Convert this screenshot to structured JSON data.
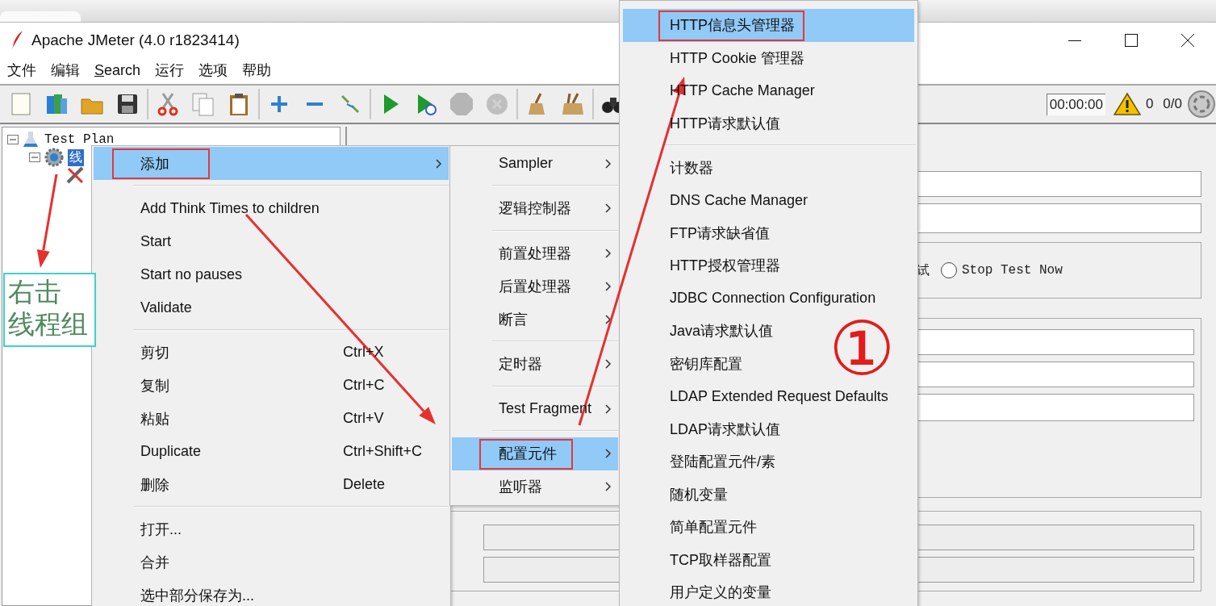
{
  "window": {
    "title": "Apache JMeter (4.0 r1823414)"
  },
  "menu_bar": [
    {
      "label": "文件",
      "underline_first": false
    },
    {
      "label": "编辑",
      "underline_first": false
    },
    {
      "label": "Search",
      "underline_first": true
    },
    {
      "label": "运行",
      "underline_first": false
    },
    {
      "label": "选项",
      "underline_first": false
    },
    {
      "label": "帮助",
      "underline_first": false
    }
  ],
  "toolbar": {
    "buttons": [
      {
        "kind": "new",
        "disabled": false
      },
      {
        "kind": "templates",
        "disabled": false
      },
      {
        "kind": "open",
        "disabled": false
      },
      {
        "kind": "save",
        "disabled": false
      },
      {
        "kind": "separator"
      },
      {
        "kind": "cut",
        "disabled": false
      },
      {
        "kind": "copy",
        "disabled": false
      },
      {
        "kind": "paste",
        "disabled": false
      },
      {
        "kind": "separator"
      },
      {
        "kind": "expand",
        "disabled": false
      },
      {
        "kind": "collapse",
        "disabled": false
      },
      {
        "kind": "toggle",
        "disabled": false
      },
      {
        "kind": "separator"
      },
      {
        "kind": "start",
        "disabled": false
      },
      {
        "kind": "start-no-pause",
        "disabled": false
      },
      {
        "kind": "stop",
        "disabled": true
      },
      {
        "kind": "shutdown",
        "disabled": true
      },
      {
        "kind": "separator"
      },
      {
        "kind": "clear",
        "disabled": false
      },
      {
        "kind": "clear-all",
        "disabled": false
      },
      {
        "kind": "separator"
      },
      {
        "kind": "search",
        "disabled": false
      }
    ],
    "timer": "00:00:00",
    "warnings": "0",
    "threads": "0/0"
  },
  "tree": [
    {
      "label": "Test Plan",
      "kind": "plan",
      "expanded": true,
      "selected": false,
      "children": [
        {
          "label": "线",
          "kind": "thread-group",
          "expanded": true,
          "selected": true,
          "children": [
            {
              "kind": "config"
            }
          ]
        }
      ]
    }
  ],
  "editor": {
    "stop_option_tail": "试",
    "stop_options": [
      {
        "label": "Stop Test Now",
        "selected": false
      }
    ]
  },
  "context_menu": {
    "items": [
      {
        "kind": "item",
        "label": "添加",
        "submenu": true,
        "selected": true,
        "framed": true
      },
      {
        "kind": "separator"
      },
      {
        "kind": "item",
        "label": "Add Think Times to children",
        "submenu": false,
        "selected": false,
        "framed": false
      },
      {
        "kind": "item",
        "label": "Start",
        "submenu": false,
        "selected": false,
        "framed": false
      },
      {
        "kind": "item",
        "label": "Start no pauses",
        "submenu": false,
        "selected": false,
        "framed": false
      },
      {
        "kind": "item",
        "label": "Validate",
        "submenu": false,
        "selected": false,
        "framed": false
      },
      {
        "kind": "separator"
      },
      {
        "kind": "item",
        "label": "剪切",
        "shortcut": "Ctrl+X",
        "submenu": false,
        "selected": false,
        "framed": false
      },
      {
        "kind": "item",
        "label": "复制",
        "shortcut": "Ctrl+C",
        "submenu": false,
        "selected": false,
        "framed": false
      },
      {
        "kind": "item",
        "label": "粘贴",
        "shortcut": "Ctrl+V",
        "submenu": false,
        "selected": false,
        "framed": false
      },
      {
        "kind": "item",
        "label": "Duplicate",
        "shortcut": "Ctrl+Shift+C",
        "submenu": false,
        "selected": false,
        "framed": false
      },
      {
        "kind": "item",
        "label": "删除",
        "shortcut": "Delete",
        "submenu": false,
        "selected": false,
        "framed": false
      },
      {
        "kind": "separator"
      },
      {
        "kind": "item",
        "label": "打开...",
        "submenu": false,
        "selected": false,
        "framed": false
      },
      {
        "kind": "item",
        "label": "合并",
        "submenu": false,
        "selected": false,
        "framed": false
      },
      {
        "kind": "item",
        "label": "选中部分保存为...",
        "submenu": false,
        "selected": false,
        "framed": false
      }
    ]
  },
  "add_submenu": {
    "items": [
      {
        "kind": "item",
        "label": "Sampler",
        "submenu": true,
        "selected": false,
        "framed": false
      },
      {
        "kind": "separator"
      },
      {
        "kind": "item",
        "label": "逻辑控制器",
        "submenu": true,
        "selected": false,
        "framed": false
      },
      {
        "kind": "separator"
      },
      {
        "kind": "item",
        "label": "前置处理器",
        "submenu": true,
        "selected": false,
        "framed": false
      },
      {
        "kind": "item",
        "label": "后置处理器",
        "submenu": true,
        "selected": false,
        "framed": false
      },
      {
        "kind": "item",
        "label": "断言",
        "submenu": true,
        "selected": false,
        "framed": false
      },
      {
        "kind": "separator"
      },
      {
        "kind": "item",
        "label": "定时器",
        "submenu": true,
        "selected": false,
        "framed": false
      },
      {
        "kind": "separator"
      },
      {
        "kind": "item",
        "label": "Test Fragment",
        "submenu": true,
        "selected": false,
        "framed": false
      },
      {
        "kind": "separator"
      },
      {
        "kind": "item",
        "label": "配置元件",
        "submenu": true,
        "selected": true,
        "framed": true
      },
      {
        "kind": "item",
        "label": "监听器",
        "submenu": true,
        "selected": false,
        "framed": false
      }
    ]
  },
  "config_submenu": {
    "items": [
      {
        "kind": "item",
        "label": "HTTP信息头管理器",
        "submenu": false,
        "selected": true,
        "framed": true
      },
      {
        "kind": "item",
        "label": "HTTP Cookie 管理器",
        "submenu": false,
        "selected": false,
        "framed": false
      },
      {
        "kind": "item",
        "label": "HTTP Cache Manager",
        "submenu": false,
        "selected": false,
        "framed": false
      },
      {
        "kind": "item",
        "label": "HTTP请求默认值",
        "submenu": false,
        "selected": false,
        "framed": false
      },
      {
        "kind": "separator"
      },
      {
        "kind": "item",
        "label": "计数器",
        "submenu": false,
        "selected": false,
        "framed": false
      },
      {
        "kind": "item",
        "label": "DNS Cache Manager",
        "submenu": false,
        "selected": false,
        "framed": false
      },
      {
        "kind": "item",
        "label": "FTP请求缺省值",
        "submenu": false,
        "selected": false,
        "framed": false
      },
      {
        "kind": "item",
        "label": "HTTP授权管理器",
        "submenu": false,
        "selected": false,
        "framed": false
      },
      {
        "kind": "item",
        "label": "JDBC Connection Configuration",
        "submenu": false,
        "selected": false,
        "framed": false
      },
      {
        "kind": "item",
        "label": "Java请求默认值",
        "submenu": false,
        "selected": false,
        "framed": false
      },
      {
        "kind": "item",
        "label": "密钥库配置",
        "submenu": false,
        "selected": false,
        "framed": false
      },
      {
        "kind": "item",
        "label": "LDAP Extended Request Defaults",
        "submenu": false,
        "selected": false,
        "framed": false
      },
      {
        "kind": "item",
        "label": "LDAP请求默认值",
        "submenu": false,
        "selected": false,
        "framed": false
      },
      {
        "kind": "item",
        "label": "登陆配置元件/素",
        "submenu": false,
        "selected": false,
        "framed": false
      },
      {
        "kind": "item",
        "label": "随机变量",
        "submenu": false,
        "selected": false,
        "framed": false
      },
      {
        "kind": "item",
        "label": "简单配置元件",
        "submenu": false,
        "selected": false,
        "framed": false
      },
      {
        "kind": "item",
        "label": "TCP取样器配置",
        "submenu": false,
        "selected": false,
        "framed": false
      },
      {
        "kind": "item",
        "label": "用户定义的变量",
        "submenu": false,
        "selected": false,
        "framed": false
      }
    ]
  },
  "annotations": {
    "note_lines": [
      "右击",
      "线程组"
    ],
    "marker": "①"
  }
}
